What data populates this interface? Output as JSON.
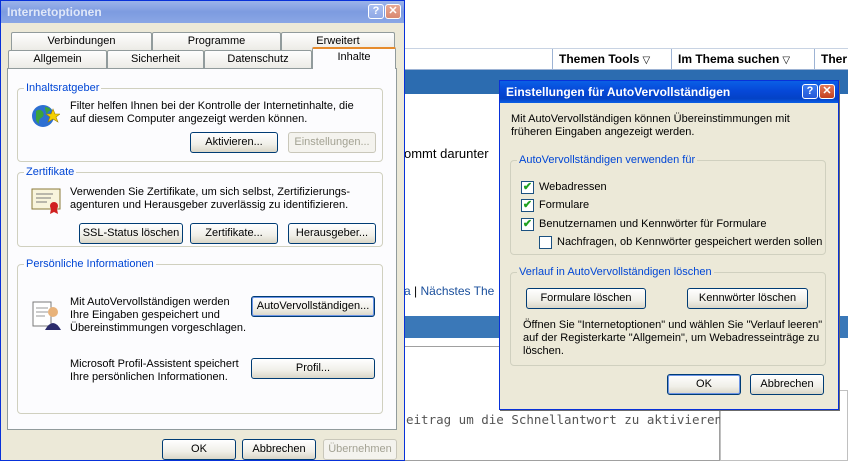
{
  "background_page": {
    "toolbar": {
      "themen_tools": "Themen Tools",
      "im_thema_suchen": "Im Thema suchen",
      "cut_off": "Ther",
      "arrow": "▽"
    },
    "snippet_1": "ommt darunter",
    "snippet_link_a": "a",
    "snippet_sep": "|",
    "snippet_link_next": "Nächstes The",
    "snippet_quick_reply": "eitrag um die Schnellantwort zu aktivieren!"
  },
  "internet_options": {
    "title": "Internetoptionen",
    "help_button": "?",
    "close_button": "✕",
    "tabs_row1": [
      "Verbindungen",
      "Programme",
      "Erweitert"
    ],
    "tabs_row2": [
      "Allgemein",
      "Sicherheit",
      "Datenschutz",
      "Inhalte"
    ],
    "content_advisor": {
      "title": "Inhaltsratgeber",
      "text": "Filter helfen Ihnen bei der Kontrolle der Internetinhalte, die auf diesem Computer angezeigt werden können.",
      "activate_button": "Aktivieren...",
      "settings_button": "Einstellungen..."
    },
    "certificates": {
      "title": "Zertifikate",
      "text": "Verwenden Sie Zertifikate, um sich selbst, Zertifizierungs-agenturen und Herausgeber zuverlässig zu identifizieren.",
      "ssl_button": "SSL-Status löschen",
      "certificates_button": "Zertifikate...",
      "publisher_button": "Herausgeber..."
    },
    "personal_info": {
      "title": "Persönliche Informationen",
      "autocomplete_text": "Mit AutoVervollständigen werden Ihre Eingaben gespeichert und Übereinstimmungen vorgeschlagen.",
      "autocomplete_button": "AutoVervollständigen...",
      "profile_text": "Microsoft Profil-Assistent speichert Ihre persönlichen Informationen.",
      "profile_button": "Profil..."
    },
    "ok_button": "OK",
    "cancel_button": "Abbrechen",
    "apply_button": "Übernehmen"
  },
  "autocomplete_dialog": {
    "title": "Einstellungen für AutoVervollständigen",
    "help_button": "?",
    "close_button": "✕",
    "intro": "Mit AutoVervollständigen können Übereinstimmungen mit früheren Eingaben angezeigt werden.",
    "use_for": {
      "title": "AutoVervollständigen verwenden für",
      "options": [
        {
          "label": "Webadressen",
          "checked": true
        },
        {
          "label": "Formulare",
          "checked": true
        },
        {
          "label": "Benutzernamen und Kennwörter für Formulare",
          "checked": true
        },
        {
          "label": "Nachfragen, ob Kennwörter gespeichert werden sollen",
          "checked": false
        }
      ]
    },
    "clear_history": {
      "title": "Verlauf in AutoVervollständigen löschen",
      "clear_forms_button": "Formulare löschen",
      "clear_passwords_button": "Kennwörter löschen",
      "info": "Öffnen Sie \"Internetoptionen\" und wählen Sie \"Verlauf leeren\" auf der Registerkarte \"Allgemein\", um Webadresseinträge zu löschen."
    },
    "ok_button": "OK",
    "cancel_button": "Abbrechen"
  }
}
